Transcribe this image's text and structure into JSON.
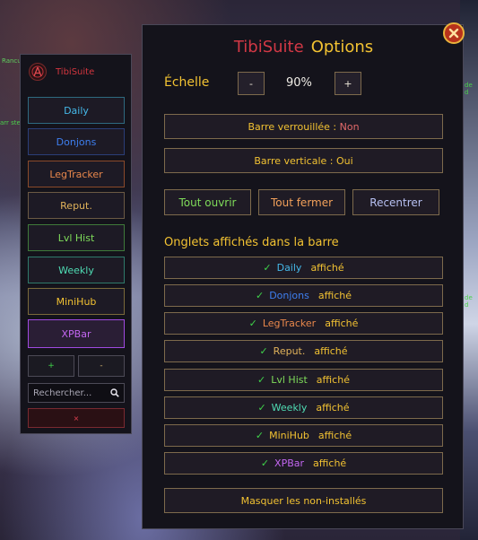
{
  "background_snippets": [
    "arr ste",
    "Rancul",
    "de d",
    "de d"
  ],
  "sidebar": {
    "title": "TibiSuite",
    "items": [
      {
        "label": "Daily",
        "color": "#45b8e8",
        "border": "#2e6a80"
      },
      {
        "label": "Donjons",
        "color": "#3e7ff0",
        "border": "#2b3e78"
      },
      {
        "label": "LegTracker",
        "color": "#e8874b",
        "border": "#8a4a2a"
      },
      {
        "label": "Reput.",
        "color": "#e0b25a",
        "border": "#6b5a44"
      },
      {
        "label": "Lvl Hist",
        "color": "#7fdc5a",
        "border": "#3f7a3a"
      },
      {
        "label": "Weekly",
        "color": "#4fdcb4",
        "border": "#2f7a6a"
      },
      {
        "label": "MiniHub",
        "color": "#f2c232",
        "border": "#7a6a3a"
      },
      {
        "label": "XPBar",
        "color": "#c266f0",
        "border": "#a04ae0"
      }
    ],
    "plus_label": "+",
    "minus_label": "-",
    "search_placeholder": "Rechercher...",
    "close_label": "×"
  },
  "options": {
    "title_part1": "TibiSuite",
    "title_part2": "Options",
    "scale_label": "Échelle",
    "scale_minus": "-",
    "scale_value": "90%",
    "scale_plus": "+",
    "lock_label": "Barre verrouillée : ",
    "lock_value": "Non",
    "vertical_label": "Barre verticale : Oui",
    "open_all": "Tout ouvrir",
    "close_all": "Tout fermer",
    "recenter": "Recentrer",
    "section_title": "Onglets affichés dans la barre",
    "check_mark": "✓",
    "status_label": "affiché",
    "tabs": [
      {
        "label": "Daily",
        "color": "#45b8e8"
      },
      {
        "label": "Donjons",
        "color": "#3e7ff0"
      },
      {
        "label": "LegTracker",
        "color": "#e8874b"
      },
      {
        "label": "Reput.",
        "color": "#e0b25a"
      },
      {
        "label": "Lvl Hist",
        "color": "#7fdc5a"
      },
      {
        "label": "Weekly",
        "color": "#4fdcb4"
      },
      {
        "label": "MiniHub",
        "color": "#f2c232"
      },
      {
        "label": "XPBar",
        "color": "#c266f0"
      }
    ],
    "hide_uninstalled": "Masquer les non-installés"
  },
  "colors": {
    "accent_yellow": "#f2c232",
    "accent_red": "#d23845",
    "check_green": "#3fd24a"
  }
}
